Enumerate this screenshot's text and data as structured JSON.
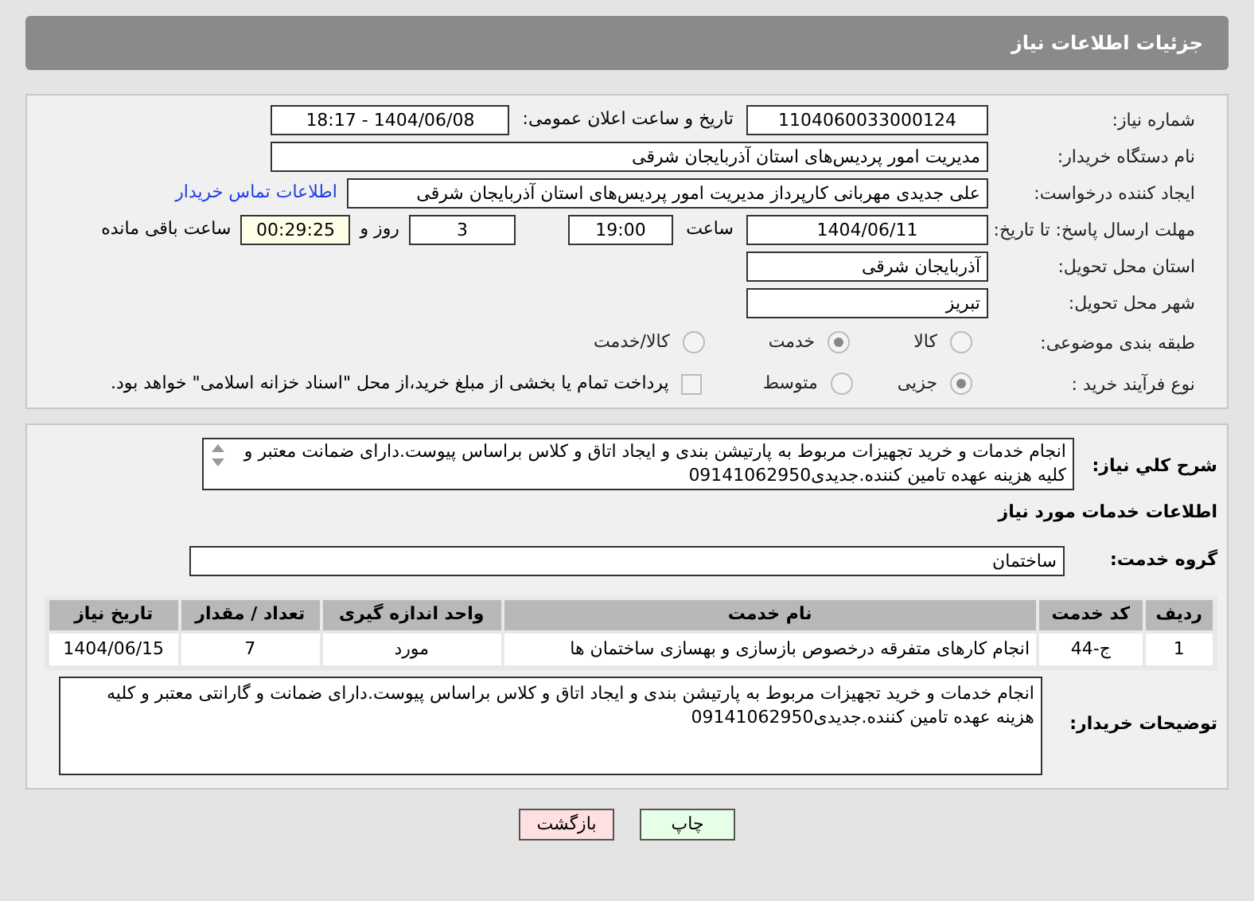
{
  "header": {
    "title": "جزئیات اطلاعات نیاز"
  },
  "need_number": {
    "label": "شماره نیاز:",
    "value": "1104060033000124"
  },
  "announce": {
    "label": "تاریخ و ساعت اعلان عمومی:",
    "value": "1404/06/08 - 18:17"
  },
  "buyer_org": {
    "label": "نام دستگاه خریدار:",
    "value": "مدیریت امور پردیس‌های استان آذربایجان شرقی"
  },
  "requester": {
    "label": "ایجاد کننده درخواست:",
    "value": "علی جدیدی مهربانی کارپرداز مدیریت امور پردیس‌های استان آذربایجان شرقی",
    "link": "اطلاعات تماس خریدار"
  },
  "deadline": {
    "label": "مهلت ارسال پاسخ: تا تاریخ:",
    "date": "1404/06/11",
    "time_label": "ساعت",
    "time": "19:00",
    "days": "3",
    "days_label": "روز و",
    "remaining": "00:29:25",
    "remaining_label": "ساعت باقی مانده"
  },
  "province": {
    "label": "استان محل تحویل:",
    "value": "آذربایجان شرقی"
  },
  "city": {
    "label": "شهر محل تحویل:",
    "value": "تبریز"
  },
  "category": {
    "label": "طبقه بندی موضوعی:",
    "options": [
      {
        "label": "کالا",
        "selected": false
      },
      {
        "label": "خدمت",
        "selected": true
      },
      {
        "label": "کالا/خدمت",
        "selected": false
      }
    ]
  },
  "purchase_type": {
    "label": "نوع فرآیند خرید :",
    "options": [
      {
        "label": "جزیی",
        "selected": true
      },
      {
        "label": "متوسط",
        "selected": false
      }
    ],
    "treasury": {
      "label": "پرداخت تمام یا بخشی از مبلغ خرید،از محل \"اسناد خزانه اسلامی\" خواهد بود.",
      "checked": false
    }
  },
  "summary": {
    "label": "شرح کلي نياز:",
    "value": "انجام خدمات و خرید تجهیزات مربوط به پارتیشن بندی و ایجاد اتاق و کلاس براساس پیوست.دارای ضمانت معتبر و کلیه هزینه عهده تامین کننده.جدیدی09141062950"
  },
  "services_title": "اطلاعات خدمات مورد نیاز",
  "service_group": {
    "label": "گروه خدمت:",
    "value": "ساختمان"
  },
  "table": {
    "columns": [
      "ردیف",
      "کد خدمت",
      "نام خدمت",
      "واحد اندازه گیری",
      "تعداد / مقدار",
      "تاریخ نیاز"
    ],
    "rows": [
      [
        "1",
        "ج-44",
        "انجام کارهای متفرقه درخصوص بازسازی و بهسازی ساختمان ها",
        "مورد",
        "7",
        "1404/06/15"
      ]
    ]
  },
  "buyer_notes": {
    "label": "توضیحات خریدار:",
    "value": "انجام خدمات و خرید تجهیزات مربوط به پارتیشن بندی و ایجاد اتاق و کلاس براساس پیوست.دارای ضمانت و گارانتی معتبر و کلیه هزینه عهده تامین کننده.جدیدی09141062950"
  },
  "buttons": [
    {
      "label": "چاپ",
      "kind": "print"
    },
    {
      "label": "بازگشت",
      "kind": "back"
    }
  ]
}
